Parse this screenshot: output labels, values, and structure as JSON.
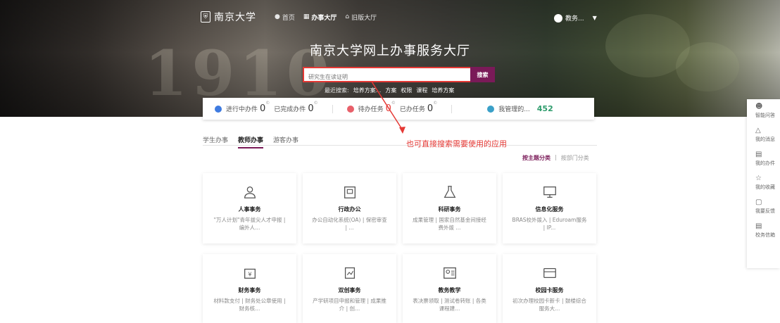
{
  "nav": {
    "logo": "南京大学",
    "items": [
      {
        "label": "首页",
        "icon": "home-icon"
      },
      {
        "label": "办事大厅",
        "icon": "hall-icon"
      },
      {
        "label": "旧版大厅",
        "icon": "building-icon"
      }
    ],
    "user": "教务..."
  },
  "hero": {
    "title": "南京大学网上办事服务大厅",
    "year_text": "1910"
  },
  "search": {
    "placeholder": "研究生在读证明",
    "button": "搜索",
    "recent_label": "最近搜索:",
    "recent": [
      "培养方案...",
      "方案",
      "权限",
      "课程",
      "培养方案"
    ]
  },
  "stats": {
    "in_progress_label": "进行中办件",
    "in_progress": "0",
    "completed_label": "已完成办件",
    "completed": "0",
    "pending_label": "待办任务",
    "pending": "0",
    "done_label": "已办任务",
    "done": "0",
    "managed_label": "我管理的...",
    "managed": "452",
    "colors": {
      "blue": "#3f7be0",
      "red": "#e8606a",
      "green": "#3aa0c8"
    }
  },
  "tabs": [
    "学生办事",
    "教师办事",
    "游客办事"
  ],
  "annotation": "也可直接搜索需要使用的应用",
  "classify": {
    "by_theme": "按主题分类",
    "sep": "|",
    "by_dept": "按部门分类"
  },
  "cards": [
    {
      "icon": "person-icon",
      "title": "人事事务",
      "desc": "\"万人计划\"青年拔尖人才申报 | 编外人..."
    },
    {
      "icon": "office-icon",
      "title": "行政办公",
      "desc": "办公自动化系统(OA) | 保密审查 | ..."
    },
    {
      "icon": "flask-icon",
      "title": "科研事务",
      "desc": "成果管理 | 国家自然基金间接经费外拨 ..."
    },
    {
      "icon": "monitor-icon",
      "title": "信息化服务",
      "desc": "BRAS校外拨入 | Eduroam服务 | IP..."
    },
    {
      "icon": "finance-icon",
      "title": "财务事务",
      "desc": "材料款支付 | 财务处公章使用 | 财务核..."
    },
    {
      "icon": "innovation-icon",
      "title": "双创事务",
      "desc": "产学研项目申报和管理 | 成果推介 | 创..."
    },
    {
      "icon": "teaching-icon",
      "title": "教务教学",
      "desc": "表决票领取 | 测试卷转账 | 各类课程建..."
    },
    {
      "icon": "card-icon",
      "title": "校园卡服务",
      "desc": "初次办理校园卡新卡 | 鼓楼综合服务大..."
    }
  ],
  "rightbar": [
    {
      "icon": "bot-icon",
      "label": "智能问答"
    },
    {
      "icon": "bell-icon",
      "label": "我的消息"
    },
    {
      "icon": "doc-icon",
      "label": "我的办件"
    },
    {
      "icon": "star-icon",
      "label": "我的收藏"
    },
    {
      "icon": "feedback-icon",
      "label": "我要反馈"
    },
    {
      "icon": "doc2-icon",
      "label": "校务信箱"
    }
  ]
}
